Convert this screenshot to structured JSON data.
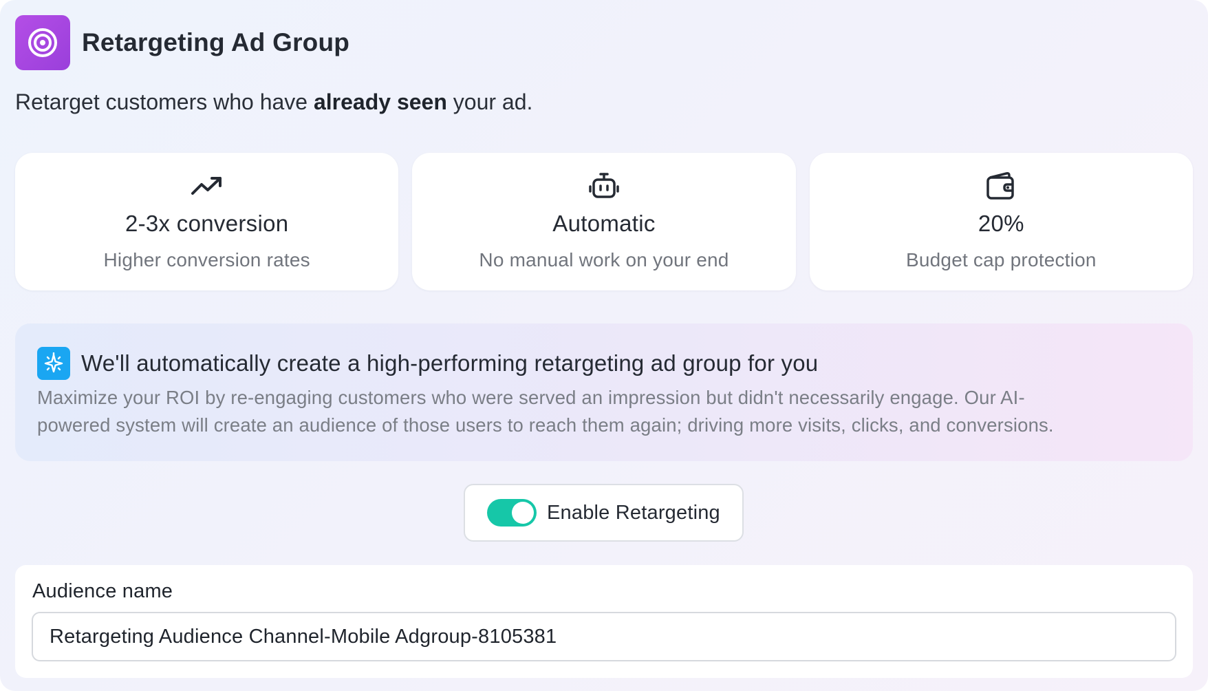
{
  "header": {
    "title": "Retargeting Ad Group",
    "icon": "target-icon",
    "icon_color": "#a646e0"
  },
  "subtitle": {
    "before": "Retarget customers who have ",
    "bold": "already seen",
    "after": " your ad."
  },
  "cards": [
    {
      "icon": "trending-up-icon",
      "value": "2-3x conversion",
      "desc": "Higher conversion rates"
    },
    {
      "icon": "robot-icon",
      "value": "Automatic",
      "desc": "No manual work on your end"
    },
    {
      "icon": "wallet-icon",
      "value": "20%",
      "desc": "Budget cap protection"
    }
  ],
  "info": {
    "icon": "sparkle-icon",
    "icon_color": "#1aa6f2",
    "title": "We'll automatically create a high-performing retargeting ad group for you",
    "body_line1": "Maximize your ROI by re-engaging customers who were served an impression but didn't necessarily engage. Our AI-",
    "body_line2": "powered system will create an audience of those users to reach them again; driving more visits, clicks, and conversions."
  },
  "toggle": {
    "label": "Enable Retargeting",
    "enabled": true,
    "color": "#16c7a8"
  },
  "form": {
    "label": "Audience name",
    "value": "Retargeting Audience Channel-Mobile Adgroup-8105381"
  }
}
